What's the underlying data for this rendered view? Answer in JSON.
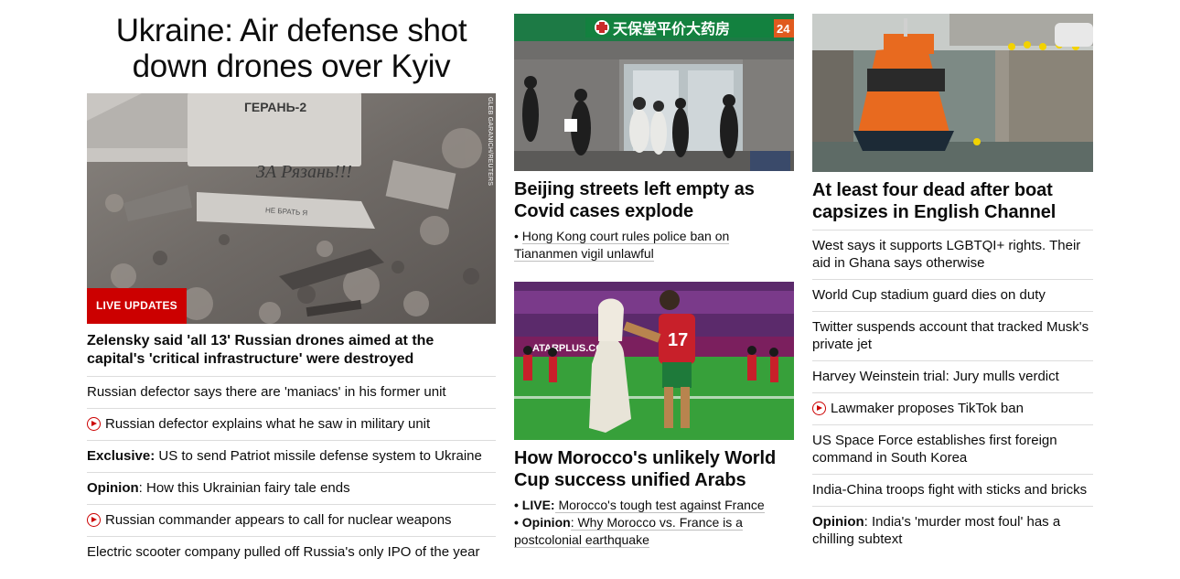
{
  "lead": {
    "headline": "Ukraine: Air defense shot down drones over Kyiv",
    "image_credit": "GLEB GARANICH/REUTERS",
    "drone_text_top": "ГЕРАНЬ-2",
    "drone_text_main": "ЗА Рязань!!!",
    "drone_text_small": "НЕ БРАТЬ Я",
    "badge": "LIVE UPDATES",
    "subhead": "Zelensky said 'all 13' Russian drones aimed at the capital's 'critical infrastructure' were destroyed",
    "related": [
      {
        "prefix": "",
        "text": "Russian defector says there are 'maniacs' in his former unit",
        "video": false
      },
      {
        "prefix": "",
        "text": "Russian defector explains what he saw in military unit",
        "video": true
      },
      {
        "prefix": "Exclusive:",
        "text": " US to send Patriot missile defense system to Ukraine",
        "video": false
      },
      {
        "prefix": "Opinion",
        "text": ": How this Ukrainian fairy tale ends",
        "video": false
      },
      {
        "prefix": "",
        "text": "Russian commander appears to call for nuclear weapons",
        "video": true
      },
      {
        "prefix": "",
        "text": "Electric scooter company pulled off Russia's only IPO of the year",
        "video": false
      }
    ]
  },
  "beijing": {
    "sign": "天保堂平价大药房",
    "sign_num": "24",
    "title": "Beijing streets left empty as Covid cases explode",
    "links": [
      {
        "prefix": "",
        "text": "Hong Kong court rules police ban on Tiananmen vigil unlawful"
      }
    ]
  },
  "morocco": {
    "jersey_number": "17",
    "ad_board": "ATARPLUS.COM",
    "title": "How Morocco's unlikely World Cup success unified Arabs",
    "links": [
      {
        "prefix": "LIVE:",
        "text": " Morocco's tough test against France"
      },
      {
        "prefix": "Opinion",
        "text": ": Why Morocco vs. France is a postcolonial earthquake"
      }
    ]
  },
  "boat": {
    "title": "At least four dead after boat capsizes in English Channel",
    "list": [
      {
        "prefix": "",
        "text": "West says it supports LGBTQI+ rights. Their aid in Ghana says otherwise",
        "video": false
      },
      {
        "prefix": "",
        "text": "World Cup stadium guard dies on duty",
        "video": false
      },
      {
        "prefix": "",
        "text": "Twitter suspends account that tracked Musk's private jet",
        "video": false
      },
      {
        "prefix": "",
        "text": "Harvey Weinstein trial: Jury mulls verdict",
        "video": false
      },
      {
        "prefix": "",
        "text": "Lawmaker proposes TikTok ban",
        "video": true
      },
      {
        "prefix": "",
        "text": "US Space Force establishes first foreign command in South Korea",
        "video": false
      },
      {
        "prefix": "",
        "text": "India-China troops fight with sticks and bricks",
        "video": false
      },
      {
        "prefix": "Opinion",
        "text": ": India's 'murder most foul' has a chilling subtext",
        "video": false
      }
    ]
  },
  "colors": {
    "accent_red": "#cc0000",
    "divider": "#dcdcdc",
    "text": "#0c0c0c"
  },
  "icons": {
    "video": "play-circle-icon"
  }
}
